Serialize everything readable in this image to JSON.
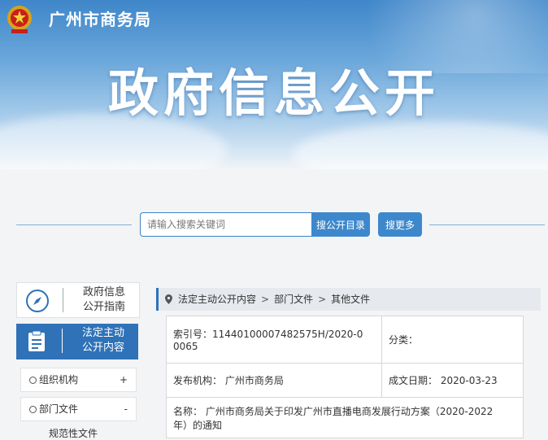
{
  "header": {
    "site_name": "广州市商务局",
    "banner_title": "政府信息公开"
  },
  "search": {
    "placeholder": "请输入搜索关键词",
    "search_button": "搜公开目录",
    "more_button": "搜更多"
  },
  "sidebar": {
    "guide_label_1": "政府信息",
    "guide_label_2": "公开指南",
    "content_label_1": "法定主动",
    "content_label_2": "公开内容",
    "items": [
      {
        "label": "组织机构",
        "toggle": "+"
      },
      {
        "label": "部门文件",
        "toggle": "-"
      }
    ],
    "sub_item": "规范性文件"
  },
  "breadcrumb": {
    "items": [
      "法定主动公开内容",
      "部门文件",
      "其他文件"
    ]
  },
  "info": {
    "index_label": "索引号：",
    "index_value_1": "11440100007482575H/2020-0",
    "index_value_2": "0065",
    "category_label": "分类：",
    "category_value": "",
    "publisher_label": "发布机构：",
    "publisher_value": "广州市商务局",
    "date_label": "成文日期：",
    "date_value": "2020-03-23",
    "name_label": "名称：",
    "name_value_1": "广州市商务局关于印发广州市直播电商发展行动方案（2020-2022",
    "name_value_2": "年）的通知"
  },
  "colors": {
    "primary_blue": "#2f72b8",
    "button_blue": "#3d88cc"
  }
}
